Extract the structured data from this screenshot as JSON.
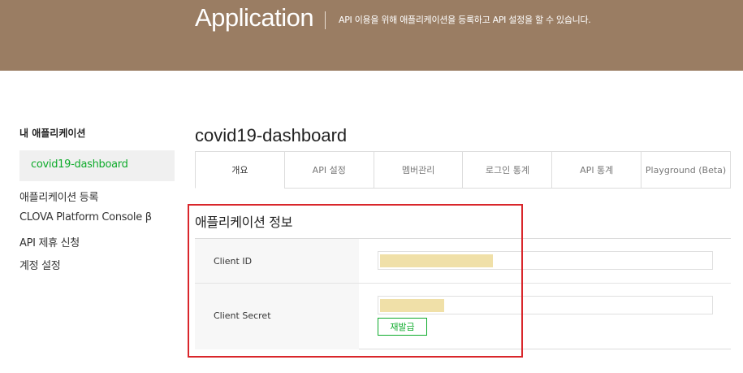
{
  "colors": {
    "hero_bg": "#9a7d63",
    "accent": "#0eab2b",
    "highlight": "#d9262b"
  },
  "header": {
    "title": "Application",
    "description": "API 이용을 위해 애플리케이션을 등록하고 API 설정을 할 수 있습니다."
  },
  "sidebar": {
    "heading": "내 애플리케이션",
    "selected_app": "covid19-dashboard",
    "links": [
      {
        "label": "애플리케이션 등록"
      },
      {
        "label": "CLOVA Platform Console β"
      },
      {
        "label": "API 제휴 신청"
      },
      {
        "label": "계정 설정"
      }
    ]
  },
  "main": {
    "app_title": "covid19-dashboard",
    "tabs": [
      {
        "label": "개요",
        "active": true
      },
      {
        "label": "API 설정"
      },
      {
        "label": "멤버관리"
      },
      {
        "label": "로그인 통계"
      },
      {
        "label": "API 통계"
      },
      {
        "label": "Playground (Beta)"
      }
    ],
    "section_title": "애플리케이션 정보",
    "client_id_label": "Client ID",
    "client_secret_label": "Client Secret",
    "reissue_label": "재발급"
  }
}
